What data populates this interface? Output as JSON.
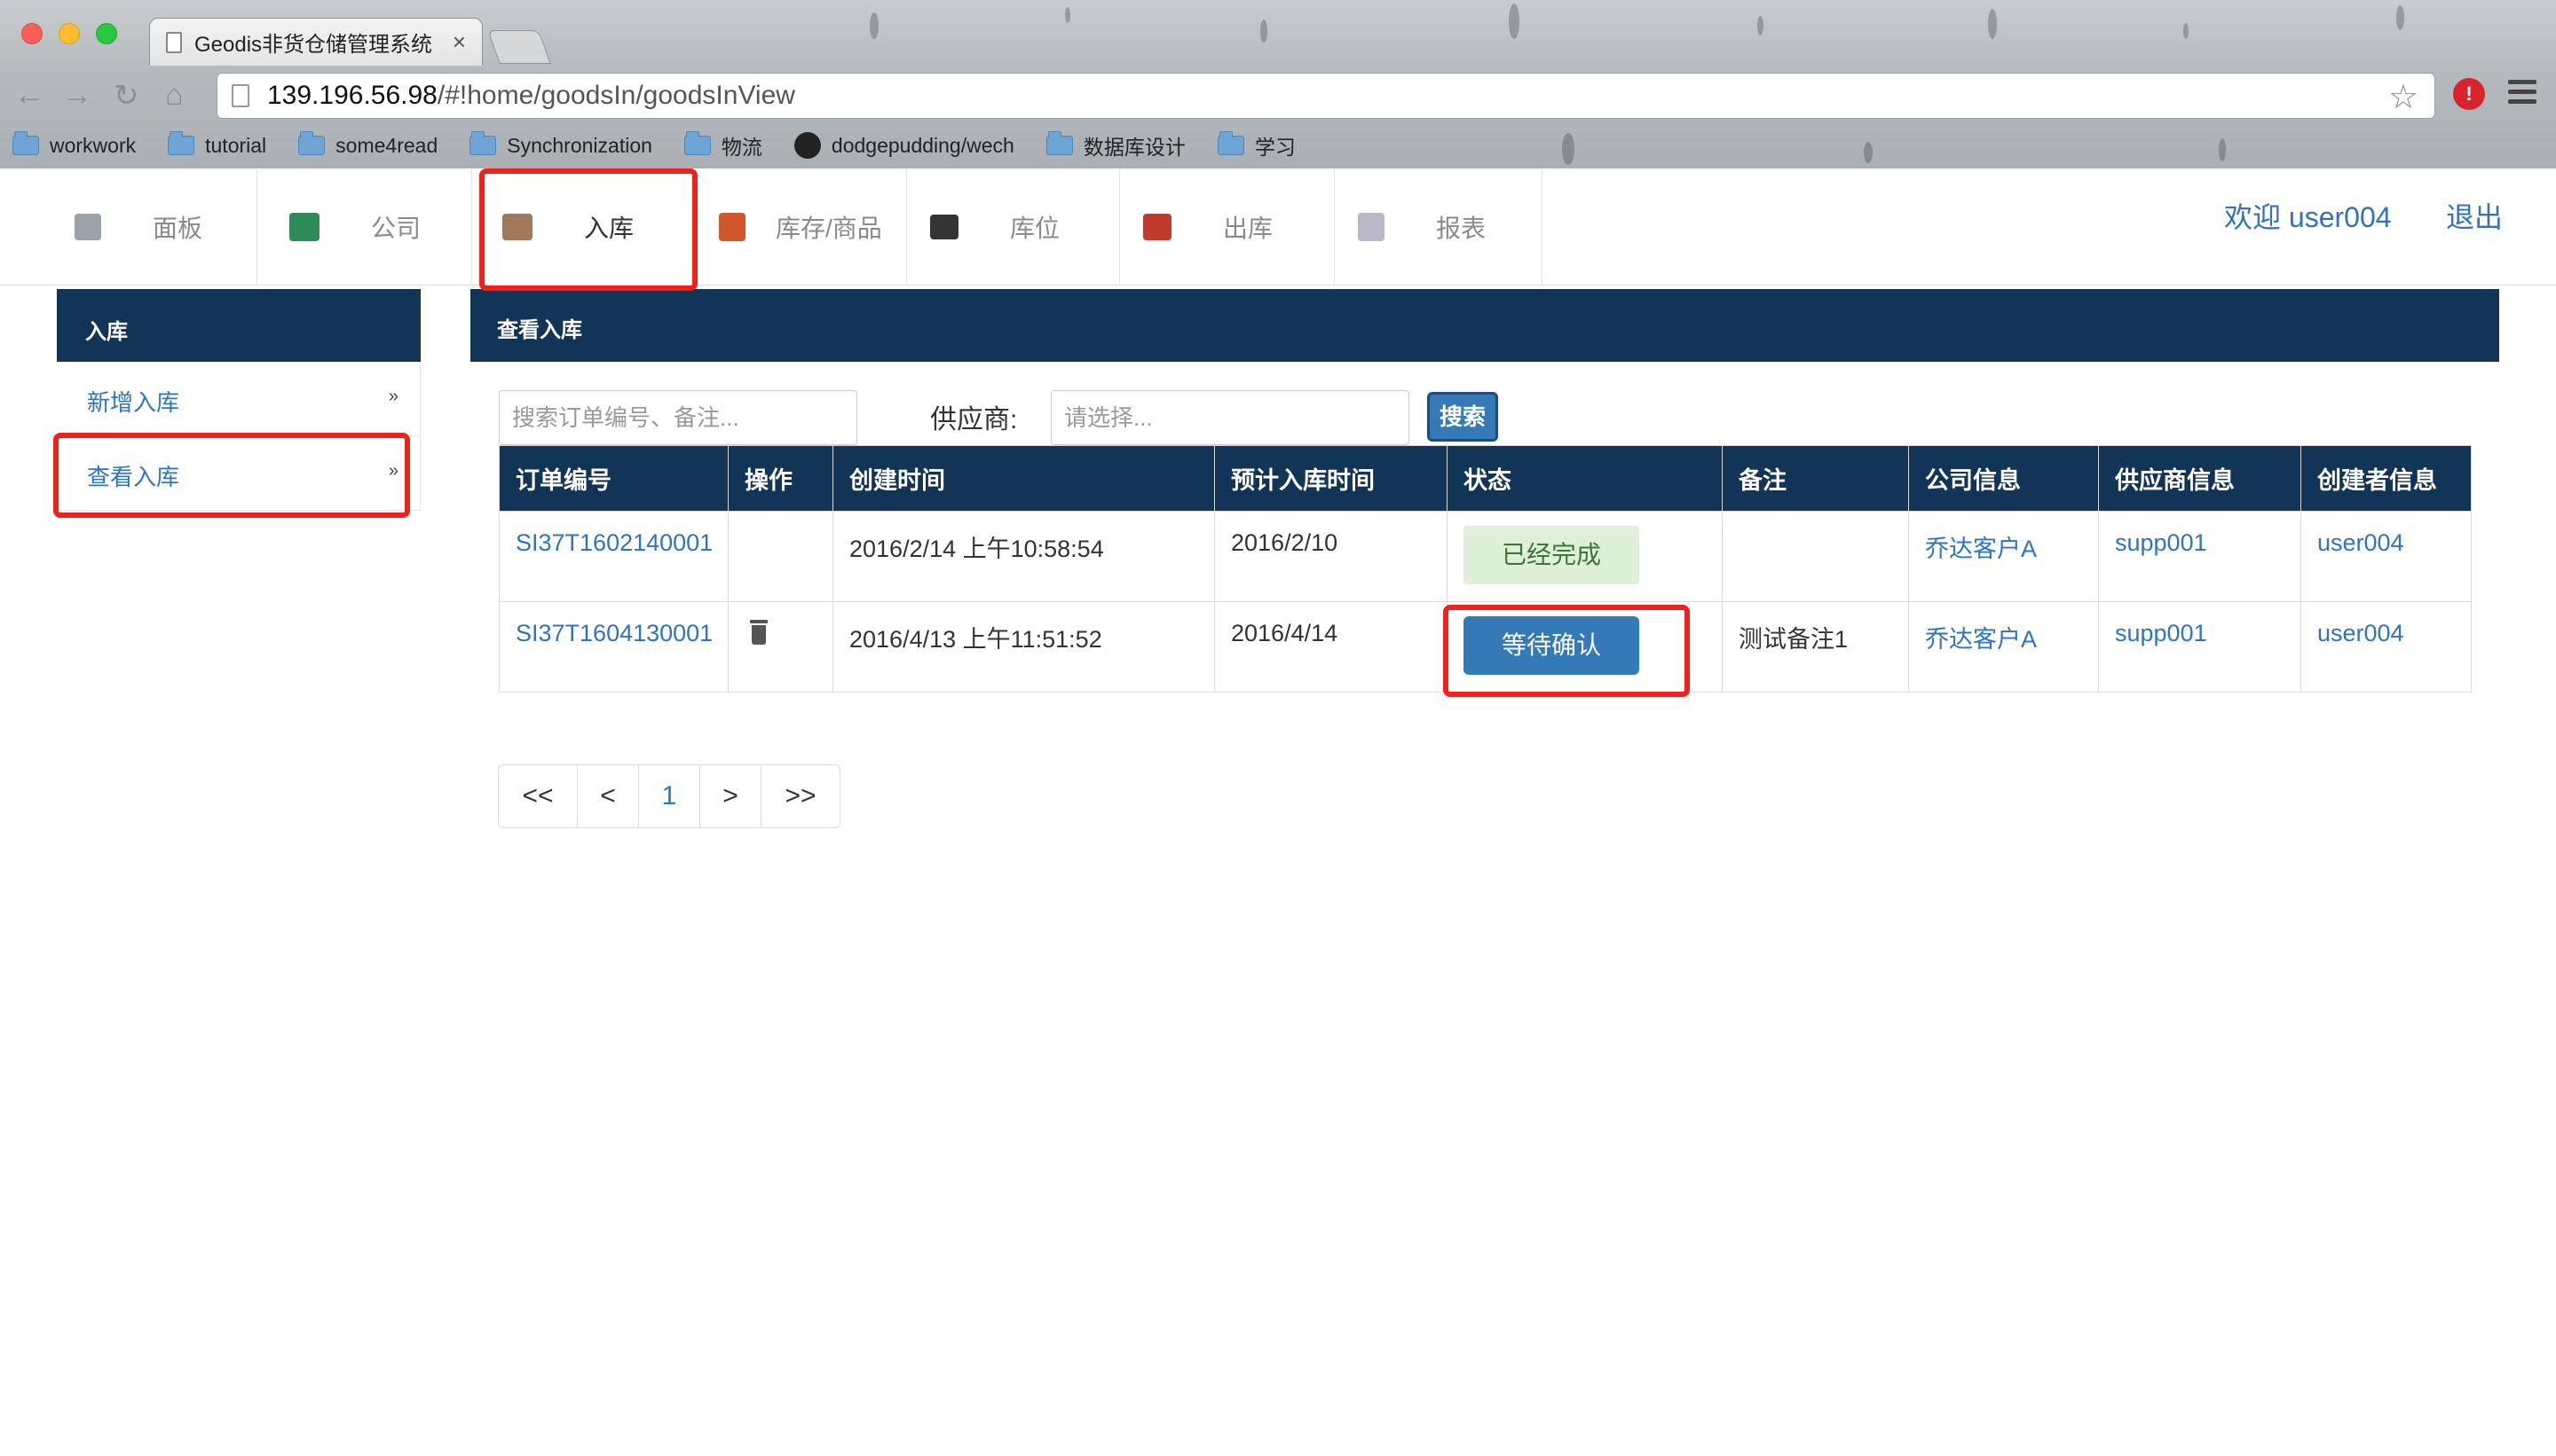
{
  "browser": {
    "tab_title": "Geodis非货仓储管理系统",
    "tab_close": "×",
    "url_host": "139.196.56.98",
    "url_path": "/#!home/goodsIn/goodsInView",
    "bookmarks": [
      "workwork",
      "tutorial",
      "some4read",
      "Synchronization",
      "物流",
      "dodgepudding/wech",
      "数据库设计",
      "学习"
    ]
  },
  "nav": {
    "items": [
      {
        "label": "面板",
        "icon": "dashboard-icon"
      },
      {
        "label": "公司",
        "icon": "users-icon"
      },
      {
        "label": "入库",
        "icon": "box-icon"
      },
      {
        "label": "库存/商品",
        "icon": "inventory-icon"
      },
      {
        "label": "库位",
        "icon": "cart-icon"
      },
      {
        "label": "出库",
        "icon": "shipping-icon"
      },
      {
        "label": "报表",
        "icon": "report-icon"
      }
    ],
    "welcome": "欢迎 user004",
    "logout": "退出"
  },
  "sidebar": {
    "title": "入库",
    "items": [
      {
        "label": "新增入库",
        "chevron": "»"
      },
      {
        "label": "查看入库",
        "chevron": "»"
      }
    ]
  },
  "main": {
    "title": "查看入库",
    "search_placeholder": "搜索订单编号、备注...",
    "supplier_label": "供应商:",
    "supplier_placeholder": "请选择...",
    "search_button": "搜索"
  },
  "table": {
    "headers": [
      "订单编号",
      "操作",
      "创建时间",
      "预计入库时间",
      "状态",
      "备注",
      "公司信息",
      "供应商信息",
      "创建者信息"
    ],
    "rows": [
      {
        "order": "SI37T1602140001",
        "created": "2016/2/14 上午10:58:54",
        "expected": "2016/2/10",
        "status": "已经完成",
        "remark": "",
        "company": "乔达客户A",
        "supplier": "supp001",
        "creator": "user004"
      },
      {
        "order": "SI37T1604130001",
        "created": "2016/4/13 上午11:51:52",
        "expected": "2016/4/14",
        "status": "等待确认",
        "remark": "测试备注1",
        "company": "乔达客户A",
        "supplier": "supp001",
        "creator": "user004"
      }
    ]
  },
  "pagination": [
    "<<",
    "<",
    "1",
    ">",
    ">>"
  ],
  "colors": {
    "navy": "#123456",
    "link": "#2f74c0",
    "primary": "#337ab7",
    "success_bg": "#dff0d8",
    "highlight": "#f0201a"
  }
}
